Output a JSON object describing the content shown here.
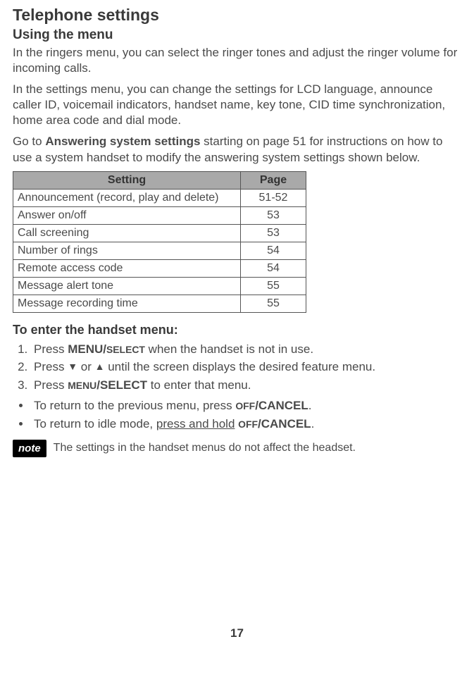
{
  "title": "Telephone settings",
  "subtitle": "Using the menu",
  "para1": "In the ringers menu, you can select the ringer tones and adjust the ringer volume for incoming calls.",
  "para2": "In the settings menu, you can change the settings for LCD language, announce caller ID, voicemail indicators, handset name, key tone, CID time synchronization, home area code and dial mode.",
  "para3_pre": "Go to ",
  "para3_bold": "Answering system settings",
  "para3_post": " starting on page 51 for instructions on how to use a system handset to modify the answering system settings shown below.",
  "table": {
    "headers": [
      "Setting",
      "Page"
    ],
    "rows": [
      {
        "setting": "Announcement (record, play and delete)",
        "page": "51-52"
      },
      {
        "setting": "Answer on/off",
        "page": "53"
      },
      {
        "setting": "Call screening",
        "page": "53"
      },
      {
        "setting": "Number of rings",
        "page": "54"
      },
      {
        "setting": "Remote access code",
        "page": "54"
      },
      {
        "setting": "Message alert tone",
        "page": "55"
      },
      {
        "setting": "Message recording time",
        "page": "55"
      }
    ]
  },
  "instructions_heading": "To enter the handset menu:",
  "step1_pre": "Press ",
  "step1_key": "MENU/",
  "step1_key2": "SELECT",
  "step1_post": " when the handset is not in use.",
  "step2_pre": "Press ",
  "step2_or": " or ",
  "step2_post": " until the screen displays the desired feature menu.",
  "step3_pre": "Press ",
  "step3_key1": "MENU",
  "step3_key2": "/SELECT",
  "step3_post": " to enter that menu.",
  "bullet1_pre": "To return to the previous menu, press ",
  "bullet1_key1": "OFF",
  "bullet1_key2": "/CANCEL",
  "bullet1_post": ".",
  "bullet2_pre": "To return to idle mode, ",
  "bullet2_underline": "press and hold",
  "bullet2_space": " ",
  "bullet2_key1": "OFF",
  "bullet2_key2": "/CANCEL",
  "bullet2_post": ".",
  "note_label": "note",
  "note_text": "The settings in the handset menus do not affect the headset.",
  "page_number": "17"
}
